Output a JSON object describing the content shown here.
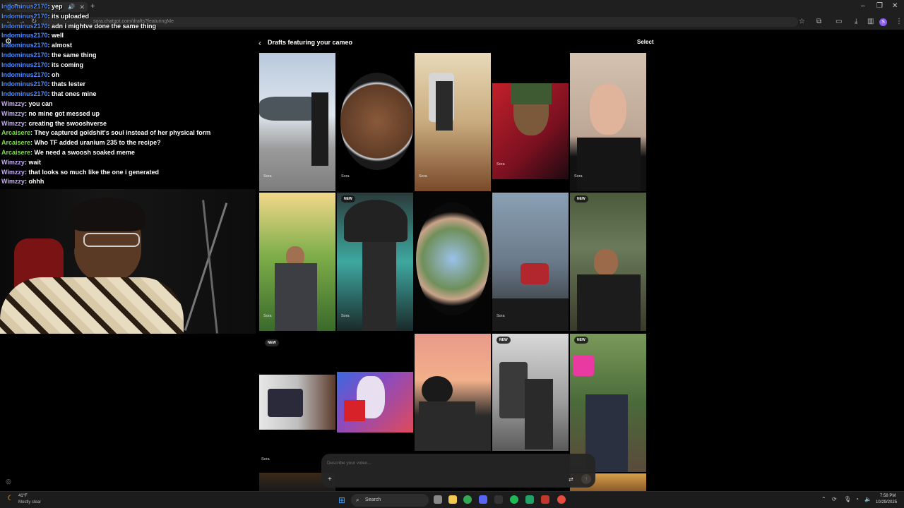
{
  "browser": {
    "tab_title": "Sora",
    "new_tab": "+",
    "address": "sora.chatgpt.com/drafts?featuringMe"
  },
  "chat": [
    {
      "user": "Indominus2170",
      "msg": "yep",
      "color": "#4a8cff"
    },
    {
      "user": "Indominus2170",
      "msg": "its uploaded",
      "color": "#4a8cff"
    },
    {
      "user": "Indominus2170",
      "msg": "adn  i mightve done the same thing",
      "color": "#4a8cff"
    },
    {
      "user": "Indominus2170",
      "msg": "well",
      "color": "#4a8cff"
    },
    {
      "user": "Indominus2170",
      "msg": "almost",
      "color": "#4a8cff"
    },
    {
      "user": "Indominus2170",
      "msg": "the same thing",
      "color": "#4a8cff"
    },
    {
      "user": "Indominus2170",
      "msg": "its coming",
      "color": "#4a8cff"
    },
    {
      "user": "Indominus2170",
      "msg": "oh",
      "color": "#4a8cff"
    },
    {
      "user": "Indominus2170",
      "msg": "thats lester",
      "color": "#4a8cff"
    },
    {
      "user": "Indominus2170",
      "msg": "that ones mine",
      "color": "#4a8cff"
    },
    {
      "user": "Wimzzy",
      "msg": "you can",
      "color": "#c8a8ff"
    },
    {
      "user": "Wimzzy",
      "msg": "no mine got messed up",
      "color": "#c8a8ff"
    },
    {
      "user": "Wimzzy",
      "msg": "creating the swooshverse",
      "color": "#c8a8ff"
    },
    {
      "user": "Arcaisere",
      "msg": "They captured goldshit's soul instead of her physical form",
      "color": "#7ddc4a"
    },
    {
      "user": "Arcaisere",
      "msg": "Who TF added uranium 235 to the recipe?",
      "color": "#7ddc4a"
    },
    {
      "user": "Arcaisere",
      "msg": "We need a swoosh soaked meme",
      "color": "#7ddc4a"
    },
    {
      "user": "Wimzzy",
      "msg": "wait",
      "color": "#c8a8ff"
    },
    {
      "user": "Wimzzy",
      "msg": "that looks so much like the one i generated",
      "color": "#c8a8ff"
    },
    {
      "user": "Wimzzy",
      "msg": "ohhh",
      "color": "#c8a8ff"
    }
  ],
  "sora": {
    "back_icon": "chevron-left-icon",
    "title": "Drafts featuring your cameo",
    "select_label": "Select",
    "new_badge": "NEW",
    "watermark": "Sora"
  },
  "prompt": {
    "placeholder": "Describe your video...",
    "plus": "+",
    "send": "↑"
  },
  "taskbar": {
    "temp": "41°F",
    "weather": "Mostly clear",
    "search_label": "Search",
    "time": "7:58 PM",
    "date": "10/29/2025"
  }
}
